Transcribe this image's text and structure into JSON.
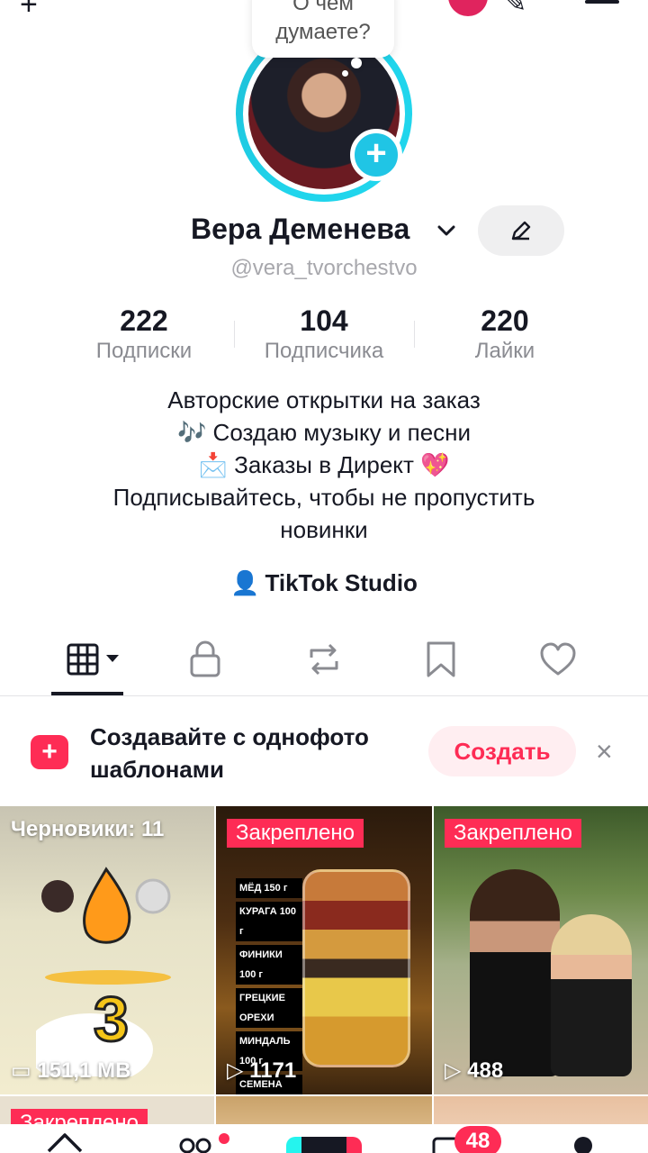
{
  "bubble": {
    "line1": "О чем",
    "line2": "думаете?"
  },
  "profile": {
    "name": "Вера Деменева",
    "handle": "@vera_tvorchestvo"
  },
  "stats": [
    {
      "value": "222",
      "label": "Подписки"
    },
    {
      "value": "104",
      "label": "Подписчика"
    },
    {
      "value": "220",
      "label": "Лайки"
    }
  ],
  "bio": {
    "line1": "Авторские открытки на заказ",
    "line2": "🎶 Создаю музыку и песни",
    "line3": "📩 Заказы в Директ  💖",
    "line4": "Подписывайтесь, чтобы не пропустить",
    "line5": "новинки"
  },
  "studio": {
    "label": "TikTok Studio"
  },
  "tabs": [
    {
      "icon": "grid-icon"
    },
    {
      "icon": "lock-icon"
    },
    {
      "icon": "repost-icon"
    },
    {
      "icon": "bookmark-icon"
    },
    {
      "icon": "heart-icon"
    }
  ],
  "banner": {
    "text_line1": "Создавайте с однофото",
    "text_line2": "шаблонами",
    "button": "Создать",
    "close": "×"
  },
  "grid": [
    {
      "overlay": "Черновики: 11",
      "meta": "151,1 MB"
    },
    {
      "overlay": "Закреплено",
      "meta": "1171"
    },
    {
      "overlay": "Закреплено",
      "meta": "488"
    }
  ],
  "row2": {
    "overlay": "Закреплено"
  },
  "nav": {
    "badge": "48"
  },
  "colors": {
    "accent": "#fe2c55",
    "ring": "#20d5ec",
    "text": "#161823",
    "muted": "#8a8b91"
  }
}
